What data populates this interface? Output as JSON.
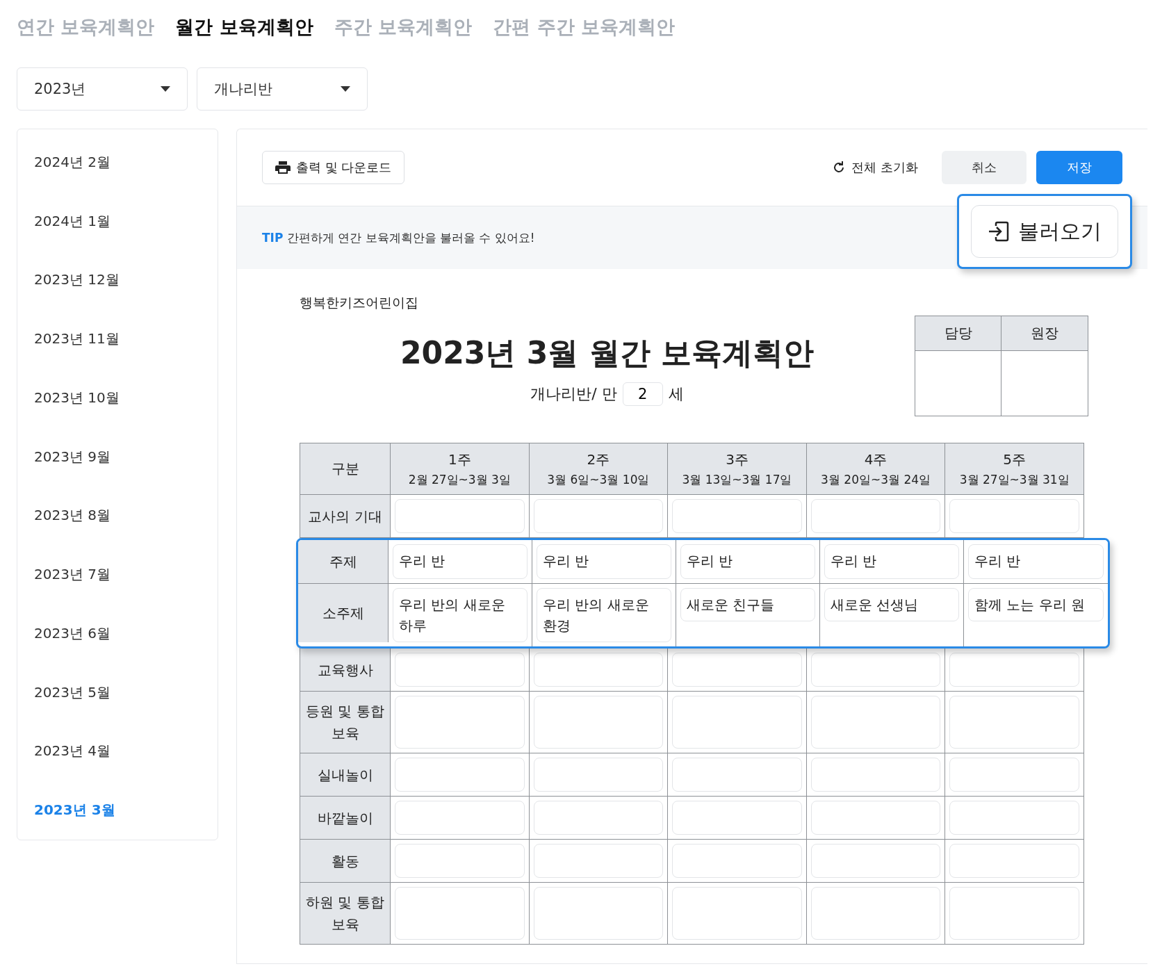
{
  "tabs": [
    {
      "label": "연간 보육계획안",
      "selected": false
    },
    {
      "label": "월간 보육계획안",
      "selected": true
    },
    {
      "label": "주간 보육계획안",
      "selected": false
    },
    {
      "label": "간편 주간 보육계획안",
      "selected": false
    }
  ],
  "filters": [
    {
      "value": "2023년"
    },
    {
      "value": "개나리반"
    }
  ],
  "sidebar": {
    "items": [
      {
        "label": "2024년 2월",
        "selected": false
      },
      {
        "label": "2024년 1월",
        "selected": false
      },
      {
        "label": "2023년 12월",
        "selected": false
      },
      {
        "label": "2023년 11월",
        "selected": false
      },
      {
        "label": "2023년 10월",
        "selected": false
      },
      {
        "label": "2023년 9월",
        "selected": false
      },
      {
        "label": "2023년 8월",
        "selected": false
      },
      {
        "label": "2023년 7월",
        "selected": false
      },
      {
        "label": "2023년 6월",
        "selected": false
      },
      {
        "label": "2023년 5월",
        "selected": false
      },
      {
        "label": "2023년 4월",
        "selected": false
      },
      {
        "label": "2023년 3월",
        "selected": true
      }
    ]
  },
  "toolbar": {
    "print": "출력 및 다운로드",
    "reset": "전체 초기화",
    "cancel": "취소",
    "save": "저장"
  },
  "tip": {
    "label": "TIP",
    "text": "간편하게 연간 보육계획안을 불러올 수 있어요!",
    "button": "불러오기"
  },
  "document": {
    "school": "행복한키즈어린이집",
    "title": "2023년 3월 월간 보육계획안",
    "class_label": "개나리반/ 만",
    "age": "2",
    "age_unit": "세",
    "approvals": [
      "담당",
      "원장"
    ],
    "table": {
      "corner": "구분",
      "weeks": [
        {
          "label": "1주",
          "dates": "2월 27일~3월 3일"
        },
        {
          "label": "2주",
          "dates": "3월 6일~3월 10일"
        },
        {
          "label": "3주",
          "dates": "3월 13일~3월 17일"
        },
        {
          "label": "4주",
          "dates": "3월 20일~3월 24일"
        },
        {
          "label": "5주",
          "dates": "3월 27일~3월 31일"
        }
      ],
      "rows": [
        {
          "label": "교사의 기대",
          "highlighted": false,
          "tall": false
        },
        {
          "label": "주제",
          "highlighted": true,
          "tall": false,
          "values": [
            "우리 반",
            "우리 반",
            "우리 반",
            "우리 반",
            "우리 반"
          ]
        },
        {
          "label": "소주제",
          "highlighted": true,
          "tall": true,
          "values": [
            "우리 반의 새로운 하루",
            "우리 반의 새로운 환경",
            "새로운 친구들",
            "새로운 선생님",
            "함께 노는 우리 원"
          ]
        },
        {
          "label": "교육행사",
          "highlighted": false,
          "tall": false
        },
        {
          "label": "등원 및 통합보육",
          "highlighted": false,
          "tall": true
        },
        {
          "label": "실내놀이",
          "highlighted": false,
          "tall": false
        },
        {
          "label": "바깥놀이",
          "highlighted": false,
          "tall": false
        },
        {
          "label": "활동",
          "highlighted": false,
          "tall": false
        },
        {
          "label": "하원 및 통합보육",
          "highlighted": false,
          "tall": true
        }
      ]
    }
  }
}
